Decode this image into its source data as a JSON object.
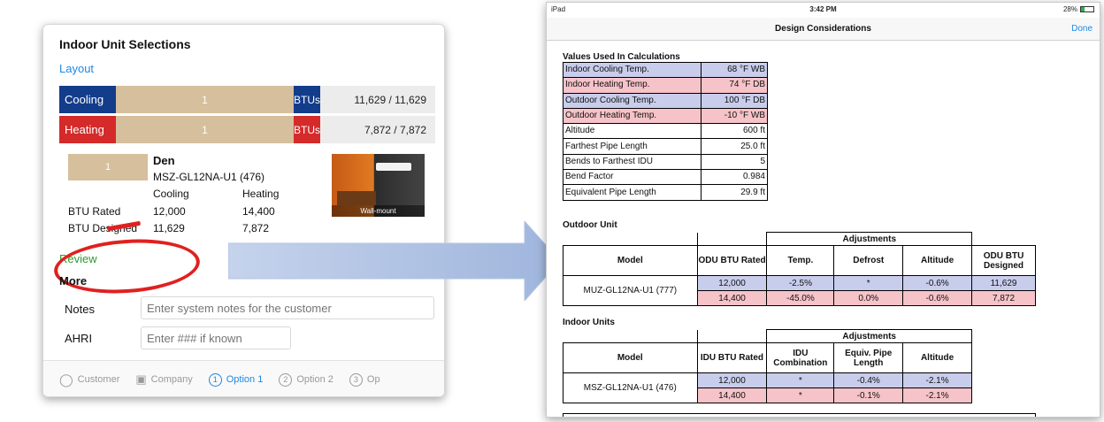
{
  "left": {
    "title": "Indoor Unit Selections",
    "layout_link": "Layout",
    "cooling_bar": {
      "label": "Cooling",
      "count": "1",
      "unit": "BTUs",
      "value": "11,629 / 11,629"
    },
    "heating_bar": {
      "label": "Heating",
      "count": "1",
      "unit": "BTUs",
      "value": "7,872 / 7,872"
    },
    "unit": {
      "tile": "1",
      "name": "Den",
      "model": "MSZ-GL12NA-U1 (476)",
      "col_cooling": "Cooling",
      "col_heating": "Heating",
      "rated_label": "BTU Rated",
      "rated_cooling": "12,000",
      "rated_heating": "14,400",
      "designed_label": "BTU Designed",
      "designed_cooling": "11,629",
      "designed_heating": "7,872",
      "photo_caption": "Wall-mount"
    },
    "review_link": "Review",
    "more_title": "More",
    "notes_label": "Notes",
    "notes_placeholder": "Enter system notes for the customer",
    "ahri_label": "AHRI",
    "ahri_placeholder": "Enter ### if known",
    "tabs": [
      {
        "label": "Customer"
      },
      {
        "label": "Company"
      },
      {
        "label": "Option 1",
        "num": "1"
      },
      {
        "label": "Option 2",
        "num": "2"
      },
      {
        "label": "Op",
        "num": "3"
      }
    ]
  },
  "right": {
    "status_left": "iPad",
    "time": "3:42 PM",
    "battery": "28%",
    "nav_title": "Design Considerations",
    "done": "Done",
    "values_title": "Values Used In Calculations",
    "values": [
      {
        "label": "Indoor Cooling Temp.",
        "value": "68 °F WB"
      },
      {
        "label": "Indoor Heating Temp.",
        "value": "74 °F DB"
      },
      {
        "label": "Outdoor Cooling Temp.",
        "value": "100 °F DB"
      },
      {
        "label": "Outdoor Heating Temp.",
        "value": "-10 °F WB"
      },
      {
        "label": "Altitude",
        "value": "600 ft"
      },
      {
        "label": "Farthest Pipe Length",
        "value": "25.0 ft"
      },
      {
        "label": "Bends to Farthest IDU",
        "value": "5"
      },
      {
        "label": "Bend Factor",
        "value": "0.984"
      },
      {
        "label": "Equivalent Pipe Length",
        "value": "29.9 ft"
      }
    ],
    "row_colors": {
      "cooling": "#c9cdec",
      "heating": "#f6c3c8"
    },
    "outdoor": {
      "title": "Outdoor Unit",
      "adjustments": "Adjustments",
      "headers": [
        "Model",
        "ODU BTU Rated",
        "Temp.",
        "Defrost",
        "Altitude",
        "ODU BTU Designed"
      ],
      "model": "MUZ-GL12NA-U1 (777)",
      "rows": [
        [
          "12,000",
          "-2.5%",
          "*",
          "-0.6%",
          "11,629"
        ],
        [
          "14,400",
          "-45.0%",
          "0.0%",
          "-0.6%",
          "7,872"
        ]
      ]
    },
    "indoor": {
      "title": "Indoor Units",
      "adjustments": "Adjustments",
      "headers": [
        "Model",
        "IDU BTU Rated",
        "IDU Combination",
        "Equiv. Pipe Length",
        "Altitude"
      ],
      "model": "MSZ-GL12NA-U1 (476)",
      "rows": [
        [
          "12,000",
          "*",
          "-0.4%",
          "-2.1%"
        ],
        [
          "*",
          "*",
          "-0.1%",
          "-2.1%"
        ]
      ],
      "row2_first": "14,400"
    }
  }
}
